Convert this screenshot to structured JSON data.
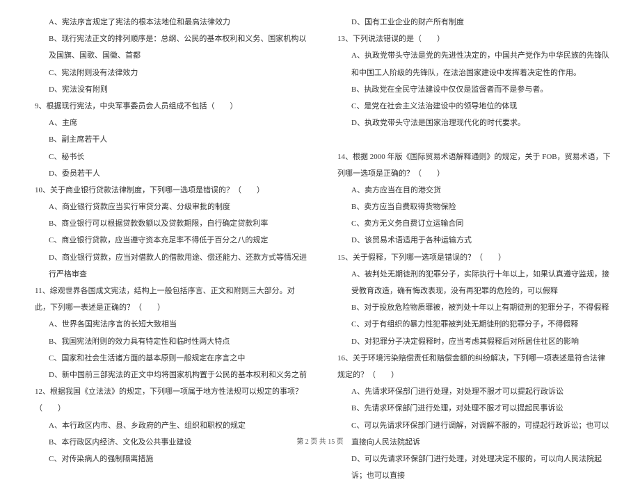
{
  "left_column": [
    {
      "cls": "option",
      "text": "A、宪法序言规定了宪法的根本法地位和最高法律效力"
    },
    {
      "cls": "option",
      "text": "B、现行宪法正文的排列顺序是：总纲、公民的基本权利和义务、国家机构以及国旗、国歌、国徽、首都"
    },
    {
      "cls": "option",
      "text": "C、宪法附则没有法律效力"
    },
    {
      "cls": "option",
      "text": "D、宪法没有附则"
    },
    {
      "cls": "question",
      "text": "9、根据现行宪法，中央军事委员会人员组成不包括（　　）"
    },
    {
      "cls": "option",
      "text": "A、主席"
    },
    {
      "cls": "option",
      "text": "B、副主席若干人"
    },
    {
      "cls": "option",
      "text": "C、秘书长"
    },
    {
      "cls": "option",
      "text": "D、委员若干人"
    },
    {
      "cls": "question",
      "text": "10、关于商业银行贷款法律制度，下列哪一选项是错误的？（　　）"
    },
    {
      "cls": "option",
      "text": "A、商业银行贷款应当实行审贷分离、分级审批的制度"
    },
    {
      "cls": "option",
      "text": "B、商业银行可以根据贷款数额以及贷款期限，自行确定贷款利率"
    },
    {
      "cls": "option",
      "text": "C、商业银行贷款，应当遵守资本充足率不得低于百分之八的规定"
    },
    {
      "cls": "option",
      "text": "D、商业银行贷款，应当对借款人的借款用途、偿还能力、还款方式等情况进行严格审查"
    },
    {
      "cls": "question",
      "text": "11、综观世界各国成文宪法，结构上一般包括序言、正文和附则三大部分。对此，下列哪一表述是正确的？（　　）"
    },
    {
      "cls": "option",
      "text": "A、世界各国宪法序言的长短大致相当"
    },
    {
      "cls": "option",
      "text": "B、我国宪法附则的效力具有特定性和临时性两大特点"
    },
    {
      "cls": "option",
      "text": "C、国家和社会生活诸方面的基本原则一般规定在序言之中"
    },
    {
      "cls": "option",
      "text": "D、新中国前三部宪法的正文中均将国家机构置于公民的基本权利和义务之前"
    },
    {
      "cls": "question",
      "text": "12、根据我国《立法法》的规定，下列哪一项属于地方性法规可以规定的事项？（　　）"
    },
    {
      "cls": "option",
      "text": "A、本行政区内市、县、乡政府的产生、组织和职权的规定"
    },
    {
      "cls": "option",
      "text": "B、本行政区内经济、文化及公共事业建设"
    },
    {
      "cls": "option",
      "text": "C、对传染病人的强制隔离措施"
    }
  ],
  "right_column": [
    {
      "cls": "option",
      "text": "D、国有工业企业的财产所有制度"
    },
    {
      "cls": "question",
      "text": "13、下列说法错误的是（　　）"
    },
    {
      "cls": "option",
      "text": "A、执政党带头守法是党的先进性决定的，中国共产党作为中华民族的先锋队和中国工人阶级的先锋队，在法治国家建设中发挥着决定性的作用。"
    },
    {
      "cls": "option",
      "text": "B、执政党在全民守法建设中仅仅是监督者而不是参与者。"
    },
    {
      "cls": "option",
      "text": "C、是党在社会主义法治建设中的领导地位的体现"
    },
    {
      "cls": "option",
      "text": "D、执政党带头守法是国家治理现代化的时代要求。"
    },
    {
      "cls": "question",
      "text": "　"
    },
    {
      "cls": "question",
      "text": "14、根据 2000 年版《国际贸易术语解释通则》的规定，关于 FOB，贸易术语，下列哪一选项是正确的？（　　）"
    },
    {
      "cls": "option",
      "text": "A、卖方应当在目的港交货"
    },
    {
      "cls": "option",
      "text": "B、卖方应当自费取得货物保险"
    },
    {
      "cls": "option",
      "text": "C、卖方无义务自费订立运输合同"
    },
    {
      "cls": "option",
      "text": "D、该贸易术语适用于各种运输方式"
    },
    {
      "cls": "question",
      "text": "15、关于假释，下列哪一选项是错误的？（　　）"
    },
    {
      "cls": "option",
      "text": "A、被判处无期徒刑的犯罪分子，实际执行十年以上，如果认真遵守监规，接受教育改造，确有悔改表现，没有再犯罪的危险的，可以假释"
    },
    {
      "cls": "option",
      "text": "B、对于投放危险物质罪被，被判处十年以上有期徒刑的犯罪分子，不得假释"
    },
    {
      "cls": "option",
      "text": "C、对于有组织的暴力性犯罪被判处无期徒刑的犯罪分子，不得假释"
    },
    {
      "cls": "option",
      "text": "D、对犯罪分子决定假释时，应当考虑其假释后对所居住社区的影响"
    },
    {
      "cls": "question",
      "text": "16、关于环境污染赔偿责任和赔偿金额的纠纷解决，下列哪一项表述是符合法律规定的？（　　）"
    },
    {
      "cls": "option",
      "text": "A、先请求环保部门进行处理，对处理不服才可以提起行政诉讼"
    },
    {
      "cls": "option",
      "text": "B、先请求环保部门进行处理，对处理不服才可以提起民事诉讼"
    },
    {
      "cls": "option",
      "text": "C、可以先请求环保部门进行调解，对调解不服的，可提起行政诉讼；也可以直接向人民法院起诉"
    },
    {
      "cls": "option",
      "text": "D、可以先请求环保部门进行处理，对处理决定不服的，可以向人民法院起诉；也可以直接"
    }
  ],
  "footer": "第 2 页 共 15 页"
}
